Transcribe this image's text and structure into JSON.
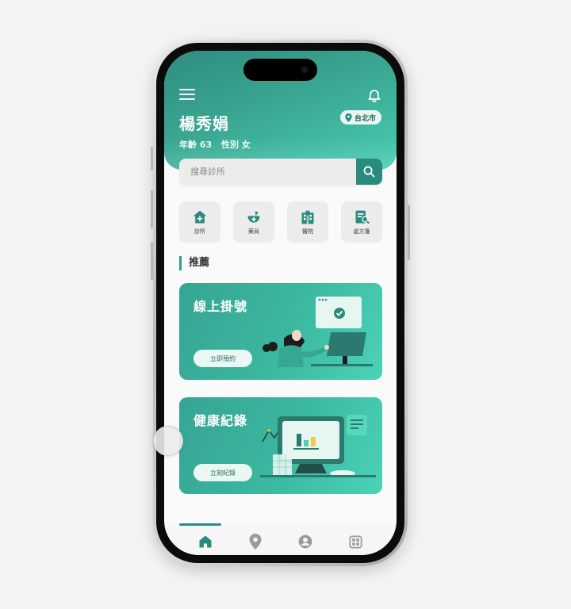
{
  "header": {
    "user_name": "楊秀娟",
    "age_label": "年齡 63",
    "gender_label": "性別 女",
    "location": "台北市"
  },
  "search": {
    "placeholder": "搜尋診所"
  },
  "quick_actions": [
    {
      "label": "診所",
      "icon": "clinic-icon"
    },
    {
      "label": "藥局",
      "icon": "pharmacy-icon"
    },
    {
      "label": "醫院",
      "icon": "hospital-icon"
    },
    {
      "label": "處方箋",
      "icon": "prescription-icon"
    }
  ],
  "section": {
    "title": "推薦"
  },
  "cards": [
    {
      "title": "線上掛號",
      "button": "立即預約",
      "illustration": "doctor-at-computer"
    },
    {
      "title": "健康紀錄",
      "button": "立刻紀錄",
      "illustration": "health-chart-monitor"
    }
  ],
  "bottom_nav": [
    {
      "icon": "home-icon",
      "active": true
    },
    {
      "icon": "location-pin-icon",
      "active": false
    },
    {
      "icon": "profile-icon",
      "active": false
    },
    {
      "icon": "grid-icon",
      "active": false
    }
  ],
  "colors": {
    "primary": "#2a8a7e",
    "accent": "#48cdb1",
    "inactive_icon": "#9a9a9a"
  }
}
